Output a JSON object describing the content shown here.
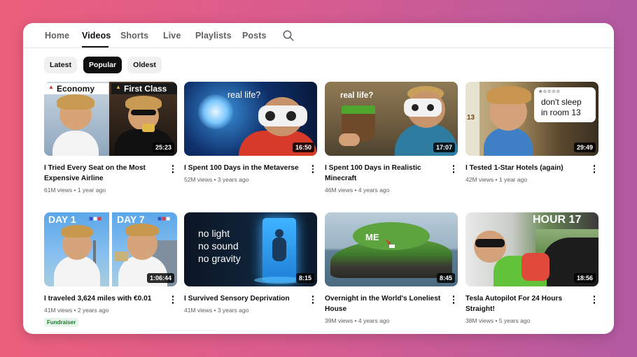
{
  "tabs": [
    {
      "label": "Home"
    },
    {
      "label": "Videos"
    },
    {
      "label": "Shorts"
    },
    {
      "label": "Live"
    },
    {
      "label": "Playlists"
    },
    {
      "label": "Posts"
    }
  ],
  "active_tab": "Videos",
  "filters": [
    {
      "label": "Latest"
    },
    {
      "label": "Popular"
    },
    {
      "label": "Oldest"
    }
  ],
  "active_filter": "Popular",
  "videos": [
    {
      "title": "I Tried Every Seat on the Most Expensive Airline",
      "views": "61M views",
      "age": "1 year ago",
      "duration": "25:23",
      "thumb_text": [
        "Economy",
        "First Class"
      ]
    },
    {
      "title": "I Spent 100 Days in the Metaverse",
      "views": "52M views",
      "age": "3 years ago",
      "duration": "16:50",
      "thumb_text": [
        "real life?"
      ]
    },
    {
      "title": "I Spent 100 Days in Realistic Minecraft",
      "views": "46M views",
      "age": "4 years ago",
      "duration": "17:07",
      "thumb_text": [
        "real life?"
      ]
    },
    {
      "title": "I Tested 1-Star Hotels (again)",
      "views": "42M views",
      "age": "1 year ago",
      "duration": "29:49",
      "thumb_text": [
        "don't sleep",
        "in room 13"
      ]
    },
    {
      "title": "I traveled 3,624 miles with €0.01",
      "views": "41M views",
      "age": "2 years ago",
      "duration": "1:06:44",
      "thumb_text": [
        "DAY 1",
        "DAY 7"
      ],
      "badge": "Fundraiser"
    },
    {
      "title": "I Survived Sensory Deprivation",
      "views": "41M views",
      "age": "3 years ago",
      "duration": "8:15",
      "thumb_text": [
        "no light",
        "no sound",
        "no gravity"
      ]
    },
    {
      "title": "Overnight in the World's Loneliest House",
      "views": "39M views",
      "age": "4 years ago",
      "duration": "8:45",
      "thumb_text": [
        "ME"
      ]
    },
    {
      "title": "Tesla Autopilot For 24 Hours Straight!",
      "views": "38M views",
      "age": "5 years ago",
      "duration": "18:56",
      "thumb_text": [
        "HOUR 17"
      ]
    }
  ],
  "meta_separator": "•"
}
